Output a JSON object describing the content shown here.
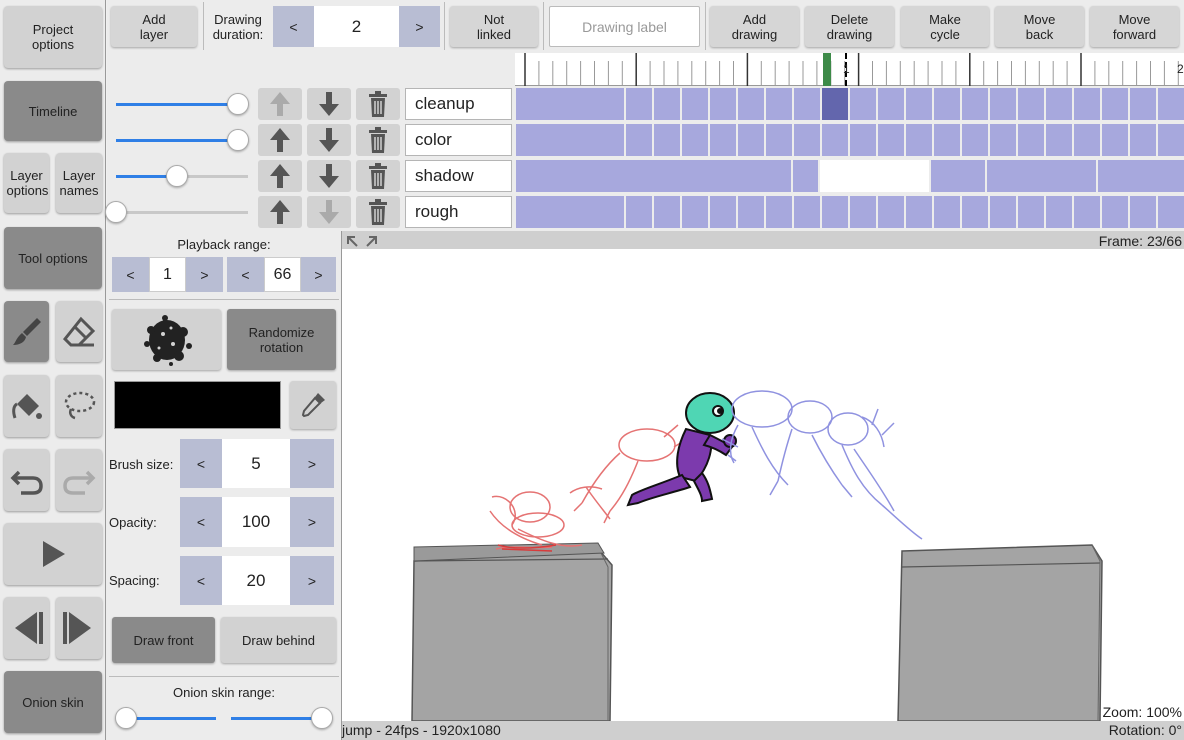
{
  "left": {
    "project_options": "Project options",
    "timeline": "Timeline",
    "layer_options": "Layer options",
    "layer_names": "Layer names",
    "tool_options": "Tool options",
    "onion_skin": "Onion skin"
  },
  "toolbar": {
    "add_layer": "Add layer",
    "drawing_duration_label": "Drawing duration:",
    "duration_dec": "<",
    "duration_value": "2",
    "duration_inc": ">",
    "not_linked": "Not linked",
    "drawing_label_placeholder": "Drawing label",
    "add_drawing": "Add drawing",
    "delete_drawing": "Delete drawing",
    "make_cycle": "Make cycle",
    "move_back": "Move back",
    "move_forward": "Move forward"
  },
  "ruler": {
    "mark1": "1",
    "mark2": "2"
  },
  "layers": [
    {
      "name": "cleanup",
      "opacity": 1.0
    },
    {
      "name": "color",
      "opacity": 1.0
    },
    {
      "name": "shadow",
      "opacity": 0.5
    },
    {
      "name": "rough",
      "opacity": 0.0
    }
  ],
  "panel": {
    "playback_range": "Playback range:",
    "range_start": "1",
    "range_end": "66",
    "dec": "<",
    "inc": ">",
    "randomize_rotation": "Randomize rotation",
    "brush_color": "#000000",
    "brush_size_label": "Brush size:",
    "brush_size": "5",
    "opacity_label": "Opacity:",
    "opacity": "100",
    "spacing_label": "Spacing:",
    "spacing": "20",
    "draw_front": "Draw front",
    "draw_behind": "Draw behind",
    "onion_skin_range": "Onion skin range:"
  },
  "status": {
    "frame": "Frame: 23/66",
    "zoom": "Zoom: 100%",
    "rotation": "Rotation: 0°",
    "project": "jump - 24fps - 1920x1080"
  },
  "colors": {
    "accent": "#2f7fe6",
    "cell": "#a7a8dd",
    "cell_selected": "#6366ad",
    "playhead": "#3d8a48"
  }
}
